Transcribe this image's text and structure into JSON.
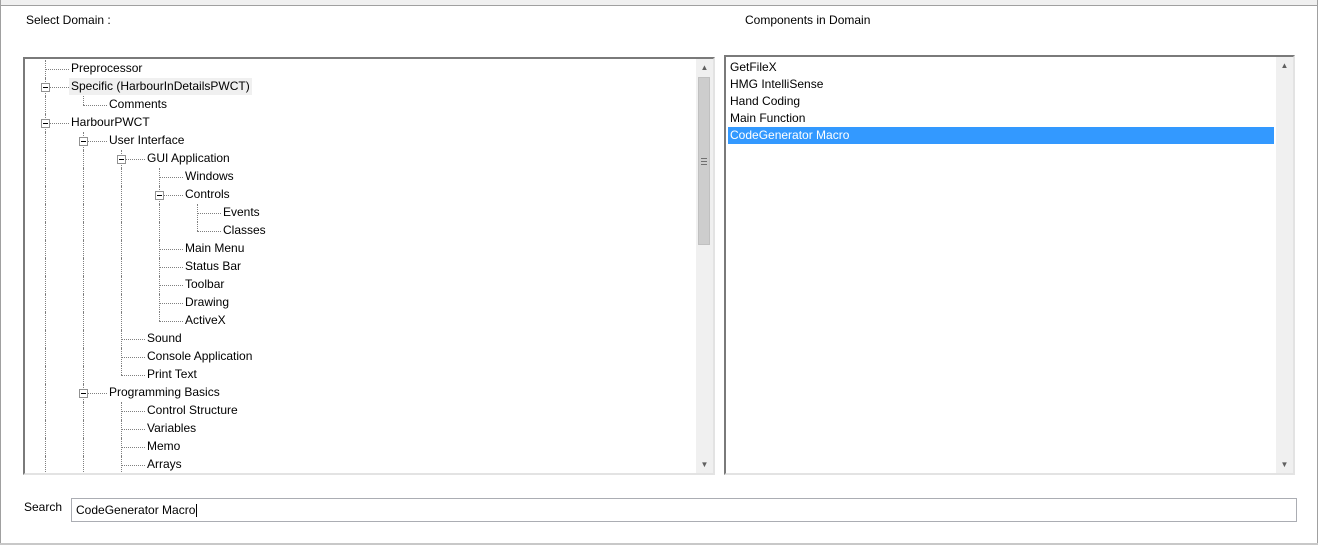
{
  "labels": {
    "select_domain": "Select Domain :",
    "components_in_domain": "Components in Domain",
    "search": "Search"
  },
  "tree": {
    "selected_item": "Specific (HarbourInDetailsPWCT)",
    "items": [
      {
        "label": "Preprocessor",
        "level": 0,
        "expanded": false
      },
      {
        "label": "Specific (HarbourInDetailsPWCT)",
        "level": 0,
        "expanded": true
      },
      {
        "label": "Comments",
        "level": 1,
        "expanded": false
      },
      {
        "label": "HarbourPWCT",
        "level": 0,
        "expanded": true
      },
      {
        "label": "User Interface",
        "level": 1,
        "expanded": true
      },
      {
        "label": "GUI Application",
        "level": 2,
        "expanded": true
      },
      {
        "label": "Windows",
        "level": 3,
        "expanded": false
      },
      {
        "label": "Controls",
        "level": 3,
        "expanded": true
      },
      {
        "label": "Events",
        "level": 4,
        "expanded": false
      },
      {
        "label": "Classes",
        "level": 4,
        "expanded": false
      },
      {
        "label": "Main Menu",
        "level": 3,
        "expanded": false
      },
      {
        "label": "Status Bar",
        "level": 3,
        "expanded": false
      },
      {
        "label": "Toolbar",
        "level": 3,
        "expanded": false
      },
      {
        "label": "Drawing",
        "level": 3,
        "expanded": false
      },
      {
        "label": "ActiveX",
        "level": 3,
        "expanded": false
      },
      {
        "label": "Sound",
        "level": 2,
        "expanded": false
      },
      {
        "label": "Console Application",
        "level": 2,
        "expanded": false
      },
      {
        "label": "Print Text",
        "level": 2,
        "expanded": false
      },
      {
        "label": "Programming Basics",
        "level": 1,
        "expanded": true
      },
      {
        "label": "Control Structure",
        "level": 2,
        "expanded": false
      },
      {
        "label": "Variables",
        "level": 2,
        "expanded": false
      },
      {
        "label": "Memo",
        "level": 2,
        "expanded": false
      },
      {
        "label": "Arrays",
        "level": 2,
        "expanded": false
      }
    ]
  },
  "components": {
    "selected_item": "CodeGenerator Macro",
    "items": [
      "GetFileX",
      "HMG IntelliSense",
      "Hand Coding",
      "Main Function",
      "CodeGenerator Macro"
    ]
  },
  "search": {
    "value": "CodeGenerator Macro"
  },
  "colors": {
    "selection": "#3399ff",
    "tree_selection": "#f0f0f0"
  },
  "icons": {
    "expander": "minus-box-icon",
    "scroll_up": "arrow-up-icon",
    "scroll_down": "arrow-down-icon"
  }
}
